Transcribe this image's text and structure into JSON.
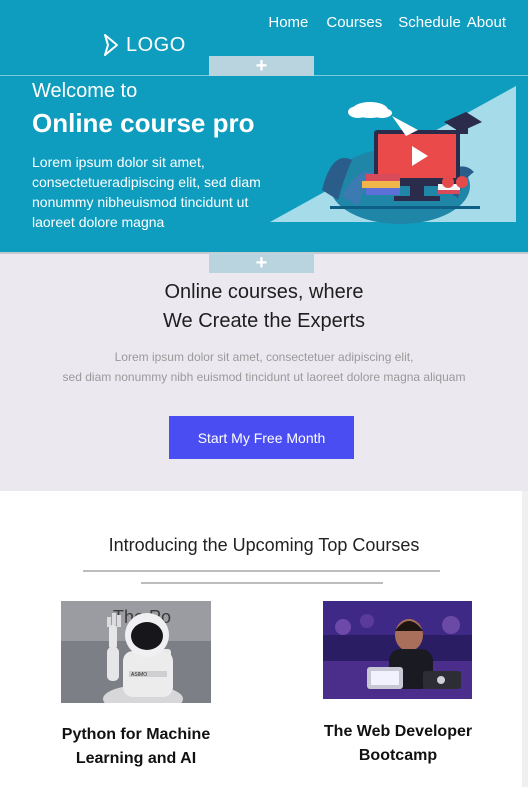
{
  "nav": {
    "items": [
      "Home",
      "Courses",
      "Schedule",
      "About"
    ]
  },
  "logo": {
    "text": "LOGO"
  },
  "plus_tab": {
    "label": "+"
  },
  "hero": {
    "welcome": "Welcome to",
    "title": "Online course pro",
    "body": "Lorem ipsum dolor sit amet, consectetueradipiscing elit, sed diam nonummy nibheuismod tincidunt ut laoreet dolore magna"
  },
  "intro": {
    "title_line1": "Online courses, where",
    "title_line2": "We Create the Experts",
    "body_line1": "Lorem ipsum dolor sit amet, consectetuer adipiscing elit,",
    "body_line2": "sed diam nonummy nibh euismod tincidunt ut laoreet dolore magna aliquam",
    "cta_label": "Start My Free Month"
  },
  "courses": {
    "heading": "Introducing the Upcoming Top Courses",
    "items": [
      {
        "title_line1": "Python for Machine",
        "title_line2": "Learning and AI",
        "image_text": "The Po",
        "badge": "ASIMO"
      },
      {
        "title_line1": "The Web Developer",
        "title_line2": "Bootcamp"
      }
    ]
  },
  "colors": {
    "header_bg": "#0f9dbf",
    "section_bg": "#ebe8ef",
    "cta_bg": "#4a4ef2"
  }
}
